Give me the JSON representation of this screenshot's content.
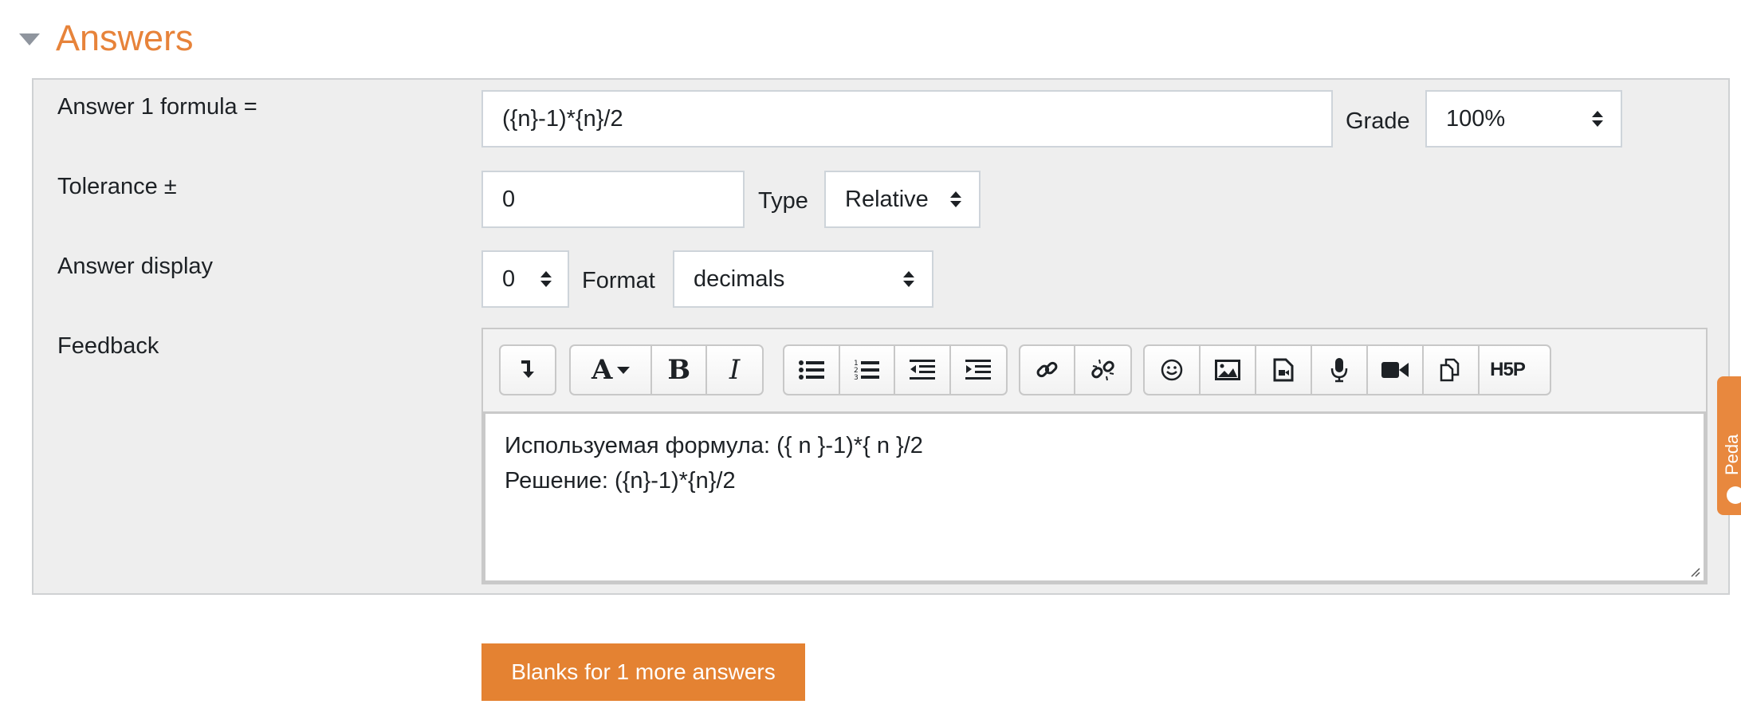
{
  "section": {
    "title": "Answers",
    "collapse_icon": "chevron-down-icon"
  },
  "answer1": {
    "formula_label": "Answer 1 formula =",
    "formula_value": "({n}-1)*{n}/2",
    "grade_label": "Grade",
    "grade_value": "100%",
    "tolerance_label": "Tolerance ±",
    "tolerance_value": "0",
    "type_label": "Type",
    "type_value": "Relative",
    "display_label": "Answer display",
    "display_value": "0",
    "format_label": "Format",
    "format_value": "decimals",
    "feedback_label": "Feedback",
    "feedback_text": "Используемая формула: ({ n }-1)*{ n }/2\nРешение: ({n}-1)*{n}/2"
  },
  "toolbar": {
    "icons": [
      "toolbar-toggle-icon",
      "font-style-icon",
      "bold-icon",
      "italic-icon",
      "unordered-list-icon",
      "ordered-list-icon",
      "outdent-icon",
      "indent-icon",
      "link-icon",
      "unlink-icon",
      "emoji-icon",
      "image-icon",
      "media-icon",
      "record-audio-icon",
      "record-video-icon",
      "manage-files-icon",
      "h5p-icon"
    ],
    "h5p_text": "H5P",
    "bold_text": "B",
    "italic_text": "I",
    "font_text": "A"
  },
  "add_blanks_button": "Blanks for 1 more answers",
  "side_tab": {
    "text": "Peda"
  },
  "colors": {
    "accent": "#e7833a",
    "button": "#e48232",
    "fieldset_bg": "#eeeeee"
  }
}
